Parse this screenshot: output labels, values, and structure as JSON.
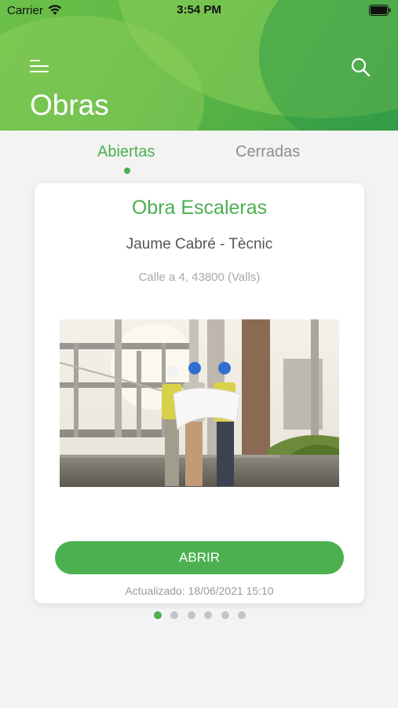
{
  "status_bar": {
    "carrier": "Carrier",
    "time": "3:54 PM"
  },
  "header": {
    "title": "Obras",
    "menu_icon": "menu-icon",
    "search_icon": "search-icon"
  },
  "tabs": [
    {
      "label": "Abiertas",
      "active": true
    },
    {
      "label": "Cerradas",
      "active": false
    }
  ],
  "card": {
    "title": "Obra Escaleras",
    "person": "Jaume Cabré - Tècnic",
    "address": "Calle a 4, 43800 (Valls)",
    "image": "construction-site-photo",
    "button_label": "ABRIR",
    "updated": "Actualizado: 18/06/2021 15:10"
  },
  "pager": {
    "count": 6,
    "active_index": 0
  },
  "colors": {
    "accent": "#4caf50",
    "header_green": "#5db846",
    "inactive_tab": "#8d8d8d",
    "pager_inactive": "#c4c4c4"
  }
}
